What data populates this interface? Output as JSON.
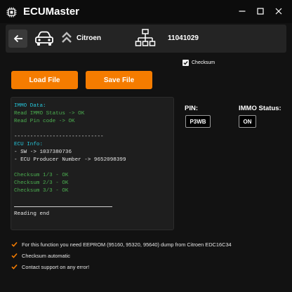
{
  "window": {
    "title": "ECUMaster"
  },
  "vehicle": {
    "brand": "Citroen",
    "serial": "11041029"
  },
  "options": {
    "checksum_label": "Checksum",
    "checksum_checked": true
  },
  "actions": {
    "load_label": "Load File",
    "save_label": "Save File"
  },
  "console": {
    "lines": [
      {
        "text": "IMMO Data:",
        "color": "cyan"
      },
      {
        "text": "Read IMMO Status -> OK",
        "color": "green"
      },
      {
        "text": "Read Pin code -> OK",
        "color": "green"
      },
      {
        "text": "",
        "color": "white"
      },
      {
        "text": "----------------------------",
        "color": "white"
      },
      {
        "text": "ECU Info:",
        "color": "cyan"
      },
      {
        "text": "- SW -> 1037380736",
        "color": "white"
      },
      {
        "text": "- ECU Producer Number -> 9652098399",
        "color": "white"
      },
      {
        "text": "",
        "color": "white"
      },
      {
        "text": "Checksum 1/3 - OK",
        "color": "green"
      },
      {
        "text": "Checksum 2/3 - OK",
        "color": "green"
      },
      {
        "text": "Checksum 3/3 - OK",
        "color": "green"
      },
      {
        "text": "",
        "color": "white"
      },
      {
        "text": "",
        "color": "rule"
      },
      {
        "text": "Reading end",
        "color": "white"
      }
    ]
  },
  "results": {
    "pin_label": "PIN:",
    "pin_value": "P3WB",
    "immo_label": "IMMO Status:",
    "immo_value": "ON"
  },
  "notes": [
    "For this function you need EEPROM (95160, 95320, 95640) dump from Citroen EDC16C34",
    "Checksum automatic",
    "Contact support on any error!"
  ],
  "colors": {
    "accent": "#f57c00",
    "cyan": "#26c6da",
    "green": "#4caf50",
    "background": "#121212"
  }
}
